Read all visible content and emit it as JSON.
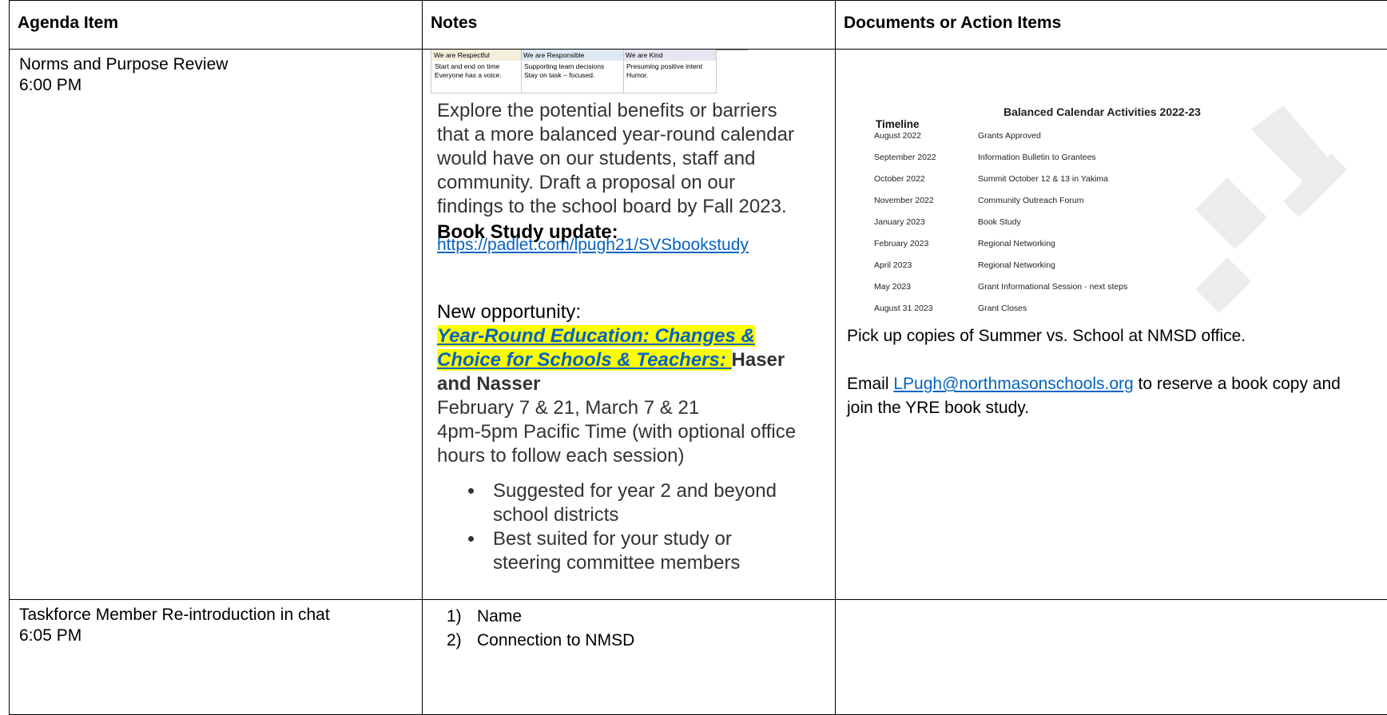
{
  "headers": {
    "agenda": "Agenda Item",
    "notes": "Notes",
    "documents": "Documents or Action Items"
  },
  "row1": {
    "agenda_title": "Norms and Purpose Review",
    "agenda_time": "6:00 PM",
    "norms": {
      "headings": [
        "We are Respectful",
        "We are Responsible",
        "We are Kind"
      ],
      "respectful": [
        "Start and end on time",
        "Everyone has a voice."
      ],
      "responsible": [
        "Supporting team decisions",
        "Stay on task – focused."
      ],
      "kind": [
        "Presuming positive intent",
        "Humor."
      ]
    },
    "purpose": "Explore the potential benefits or barriers that a more balanced year-round calendar would have on our students, staff and community. Draft a proposal on our findings to the school board by Fall 2023.",
    "book_study_heading": "Book Study update:",
    "book_study_link": "https://padlet.com/lpugh21/SVSbookstudy",
    "opportunity_label": "New opportunity:",
    "opportunity_title": "Year-Round Education:  Changes & Choice for Schools & Teachers: ",
    "opportunity_presenters": "Haser and Nasser",
    "opportunity_dates": "February 7 & 21, March 7 & 21",
    "opportunity_time": "4pm-5pm Pacific Time (with optional office hours to follow each session)",
    "bullets": [
      "Suggested for year 2 and beyond school districts",
      "Best suited for your study or steering committee members"
    ],
    "calendar": {
      "title": "Balanced Calendar Activities 2022-23",
      "timeline_label": "Timeline",
      "rows": [
        {
          "date": "August 2022",
          "activity": "Grants Approved"
        },
        {
          "date": "September 2022",
          "activity": "Information Bulletin to Grantees"
        },
        {
          "date": "October 2022",
          "activity": "Summit October 12 & 13 in Yakima"
        },
        {
          "date": "November 2022",
          "activity": "Community Outreach Forum"
        },
        {
          "date": "January 2023",
          "activity": "Book Study"
        },
        {
          "date": "February 2023",
          "activity": "Regional Networking"
        },
        {
          "date": "April 2023",
          "activity": "Regional Networking"
        },
        {
          "date": "May 2023",
          "activity": "Grant Informational Session - next steps"
        },
        {
          "date": "August 31 2023",
          "activity": "Grant Closes"
        }
      ]
    },
    "pickup_text": "Pick up copies of Summer vs. School at NMSD office.",
    "email_prefix": "Email ",
    "email_link": "LPugh@northmasonschools.org",
    "email_suffix": " to reserve a book copy and join the YRE book study."
  },
  "row2": {
    "agenda_title": "Taskforce Member Re-introduction in chat",
    "agenda_time": "6:05 PM",
    "items": [
      {
        "num": "1)",
        "text": "Name"
      },
      {
        "num": "2)",
        "text": "Connection to NMSD"
      }
    ]
  }
}
